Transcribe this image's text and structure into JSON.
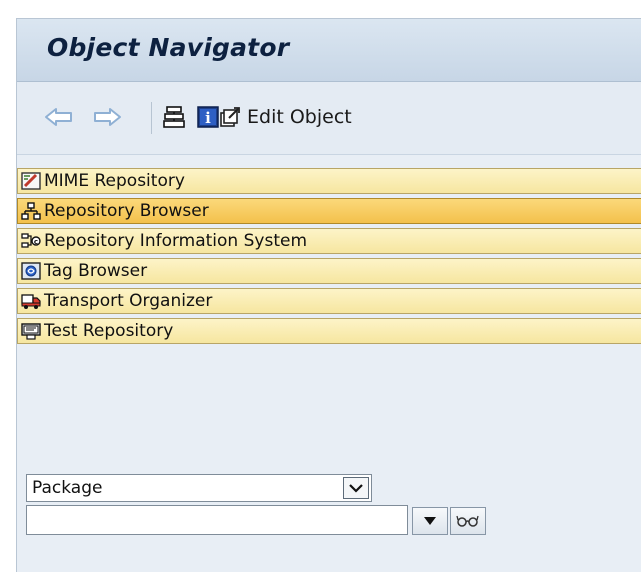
{
  "window": {
    "title": "Object Navigator"
  },
  "toolbar": {
    "back_icon": "arrow-left-icon",
    "forward_icon": "arrow-right-icon",
    "other_object_icon": "stack-icon",
    "info_icon": "info-icon",
    "edit_object_label": "Edit Object"
  },
  "nav": {
    "items": [
      {
        "label": "MIME Repository",
        "icon": "mime-repository-icon",
        "active": false
      },
      {
        "label": "Repository Browser",
        "icon": "hierarchy-icon",
        "active": true
      },
      {
        "label": "Repository Information System",
        "icon": "info-system-icon",
        "active": false
      },
      {
        "label": "Tag Browser",
        "icon": "tag-browser-icon",
        "active": false
      },
      {
        "label": "Transport Organizer",
        "icon": "truck-icon",
        "active": false
      },
      {
        "label": "Test Repository",
        "icon": "test-repository-icon",
        "active": false
      }
    ]
  },
  "object_selector": {
    "selected": "Package",
    "input_value": ""
  },
  "colors": {
    "title_text": "#0d2140",
    "nav_item_bg": "#f6e6a0",
    "nav_item_active_bg": "#f3c14c",
    "toolbar_arrows": "#8fb0d4"
  }
}
